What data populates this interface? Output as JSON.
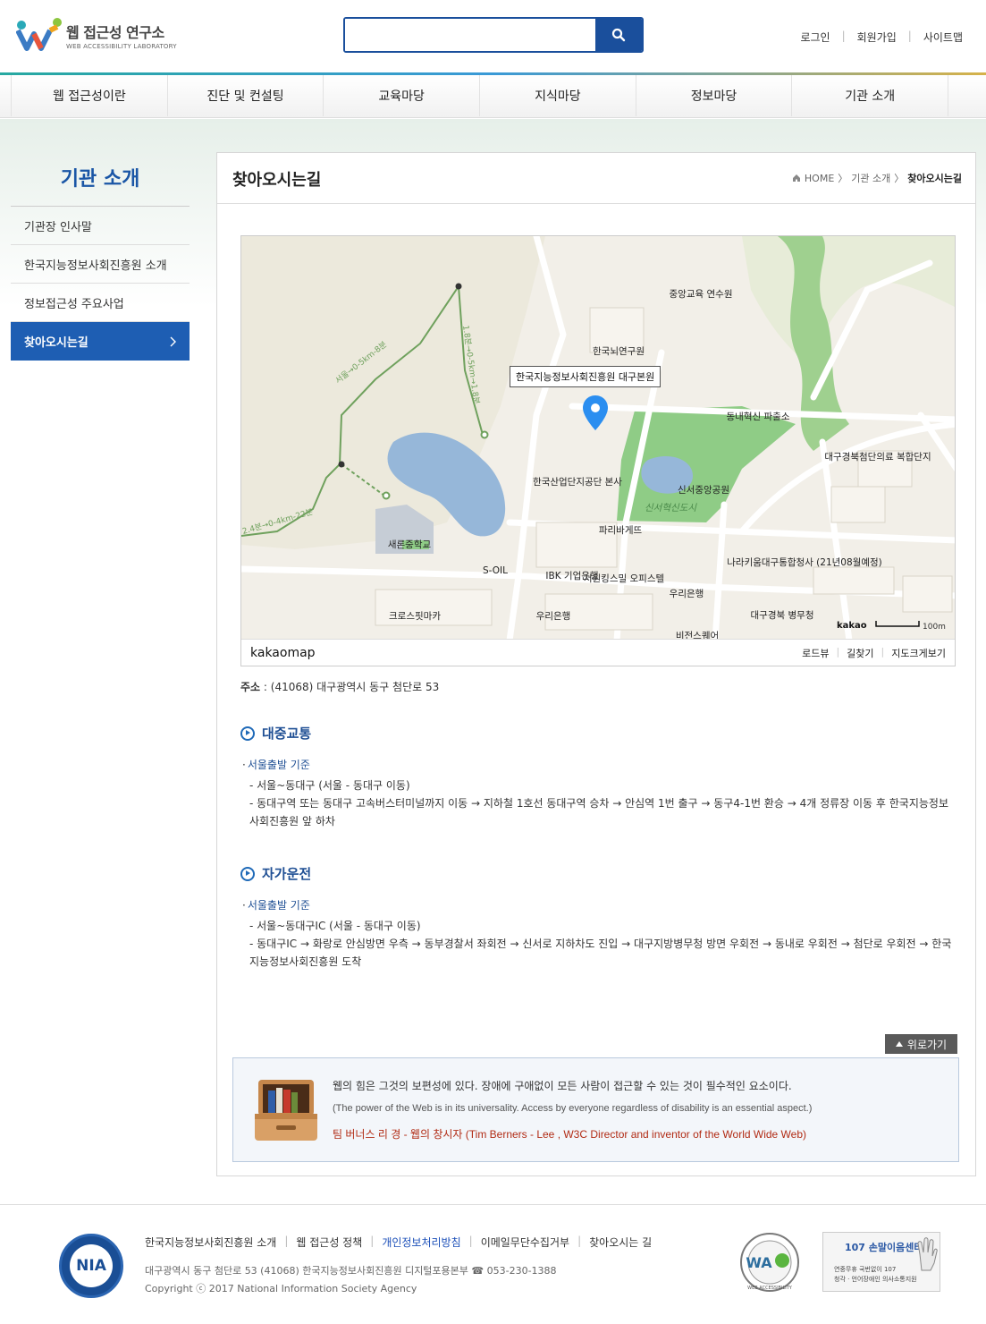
{
  "header": {
    "logo_title": "웹 접근성 연구소",
    "logo_sub": "WEB ACCESSIBILITY LABORATORY",
    "search_placeholder": "",
    "util_links": [
      "로그인",
      "회원가입",
      "사이트맵"
    ]
  },
  "gnb": [
    "웹 접근성이란",
    "진단 및 컨설팅",
    "교육마당",
    "지식마당",
    "정보마당",
    "기관 소개"
  ],
  "lnb": {
    "title": "기관 소개",
    "items": [
      {
        "label": "기관장 인사말",
        "active": false
      },
      {
        "label": "한국지능정보사회진흥원 소개",
        "active": false
      },
      {
        "label": "정보접근성 주요사업",
        "active": false
      },
      {
        "label": "찾아오시는길",
        "active": true
      }
    ]
  },
  "content": {
    "title": "찾아오시는길",
    "breadcrumb": [
      "HOME",
      "기관 소개",
      "찾아오시는길"
    ]
  },
  "map": {
    "marker_label": "한국지능정보사회진흥원 대구본원",
    "places": [
      "중앙교육 연수원",
      "한국뇌연구원",
      "동내혁신 파출소",
      "대구경북첨단의료 복합단지",
      "한국산업단지공단 본사",
      "신서중앙공원",
      "신서혁신도시",
      "파리바게뜨",
      "나라키움대구통합청사 (21년08월예정)",
      "새론중학교",
      "S-OIL",
      "IBK 기업은행",
      "서원킹스밀 오피스텔",
      "우리은행",
      "우리은행",
      "크로스핏마카",
      "대구경북 병무청",
      "비전스퀘어"
    ],
    "trail_labels": [
      "서울→0-5km-8분",
      "1.8분→0-5km→1.8분",
      "2.4분→0-4km-22분"
    ],
    "scale_label": "100m",
    "brand_small": "kakao",
    "brand": "kakaomap",
    "links": [
      "로드뷰",
      "길찾기",
      "지도크게보기"
    ]
  },
  "address": {
    "label": "주소",
    "value": "(41068) 대구광역시 동구 첨단로 53"
  },
  "transit": {
    "title": "대중교통",
    "subtitle": "서울출발 기준",
    "lines": [
      "- 서울~동대구 (서울 - 동대구 이동)",
      "- 동대구역 또는 동대구 고속버스터미널까지 이동 → 지하철 1호선 동대구역 승차 → 안심역 1번 출구 → 동구4-1번 환승 → 4개 정류장 이동 후 한국지능정보사회진흥원 앞 하차"
    ]
  },
  "car": {
    "title": "자가운전",
    "subtitle": "서울출발 기준",
    "lines": [
      "- 서울~동대구IC (서울 - 동대구 이동)",
      "- 동대구IC → 화랑로 안심방면 우측 → 동부경찰서 좌회전 → 신서로 지하차도 진입 → 대구지방병무청 방면 우회전 → 동내로 우회전 → 첨단로 우회전 → 한국지능정보사회진흥원 도착"
    ]
  },
  "top_button": "위로가기",
  "quote": {
    "korean": "웹의 힘은 그것의 보편성에 있다. 장애에 구애없이 모든 사람이 접근할 수 있는 것이 필수적인 요소이다.",
    "english": "(The power of the Web is in its universality. Access by everyone regardless of disability is an essential aspect.)",
    "author": "팀 버너스 리 경 - 웹의 창시자 (Tim Berners - Lee , W3C Director and inventor of the World Wide Web)"
  },
  "footer": {
    "logo": "NIA",
    "links": [
      "한국지능정보사회진흥원 소개",
      "웹 접근성 정책",
      "개인정보처리방침",
      "이메일무단수집거부",
      "찾아오시는 길"
    ],
    "address": "대구광역시 동구 첨단로 53 (41068) 한국지능정보사회진흥원 디지털포용본부 ☎ 053-230-1388",
    "copyright": "Copyright ⓒ 2017 National Information Society Agency",
    "wa_badge": "WEB ACCESSIBILITY",
    "center_title": "107 손말이음센터",
    "center_sub1": "연중무휴 국번없이 107",
    "center_sub2": "청각 · 언어장애인 의사소통지원"
  },
  "colors": {
    "primary": "#1a4f9c",
    "lnb_active": "#1e5eb3",
    "author": "#b12b14",
    "park": "#8fcc86",
    "water": "#96b7d9"
  }
}
